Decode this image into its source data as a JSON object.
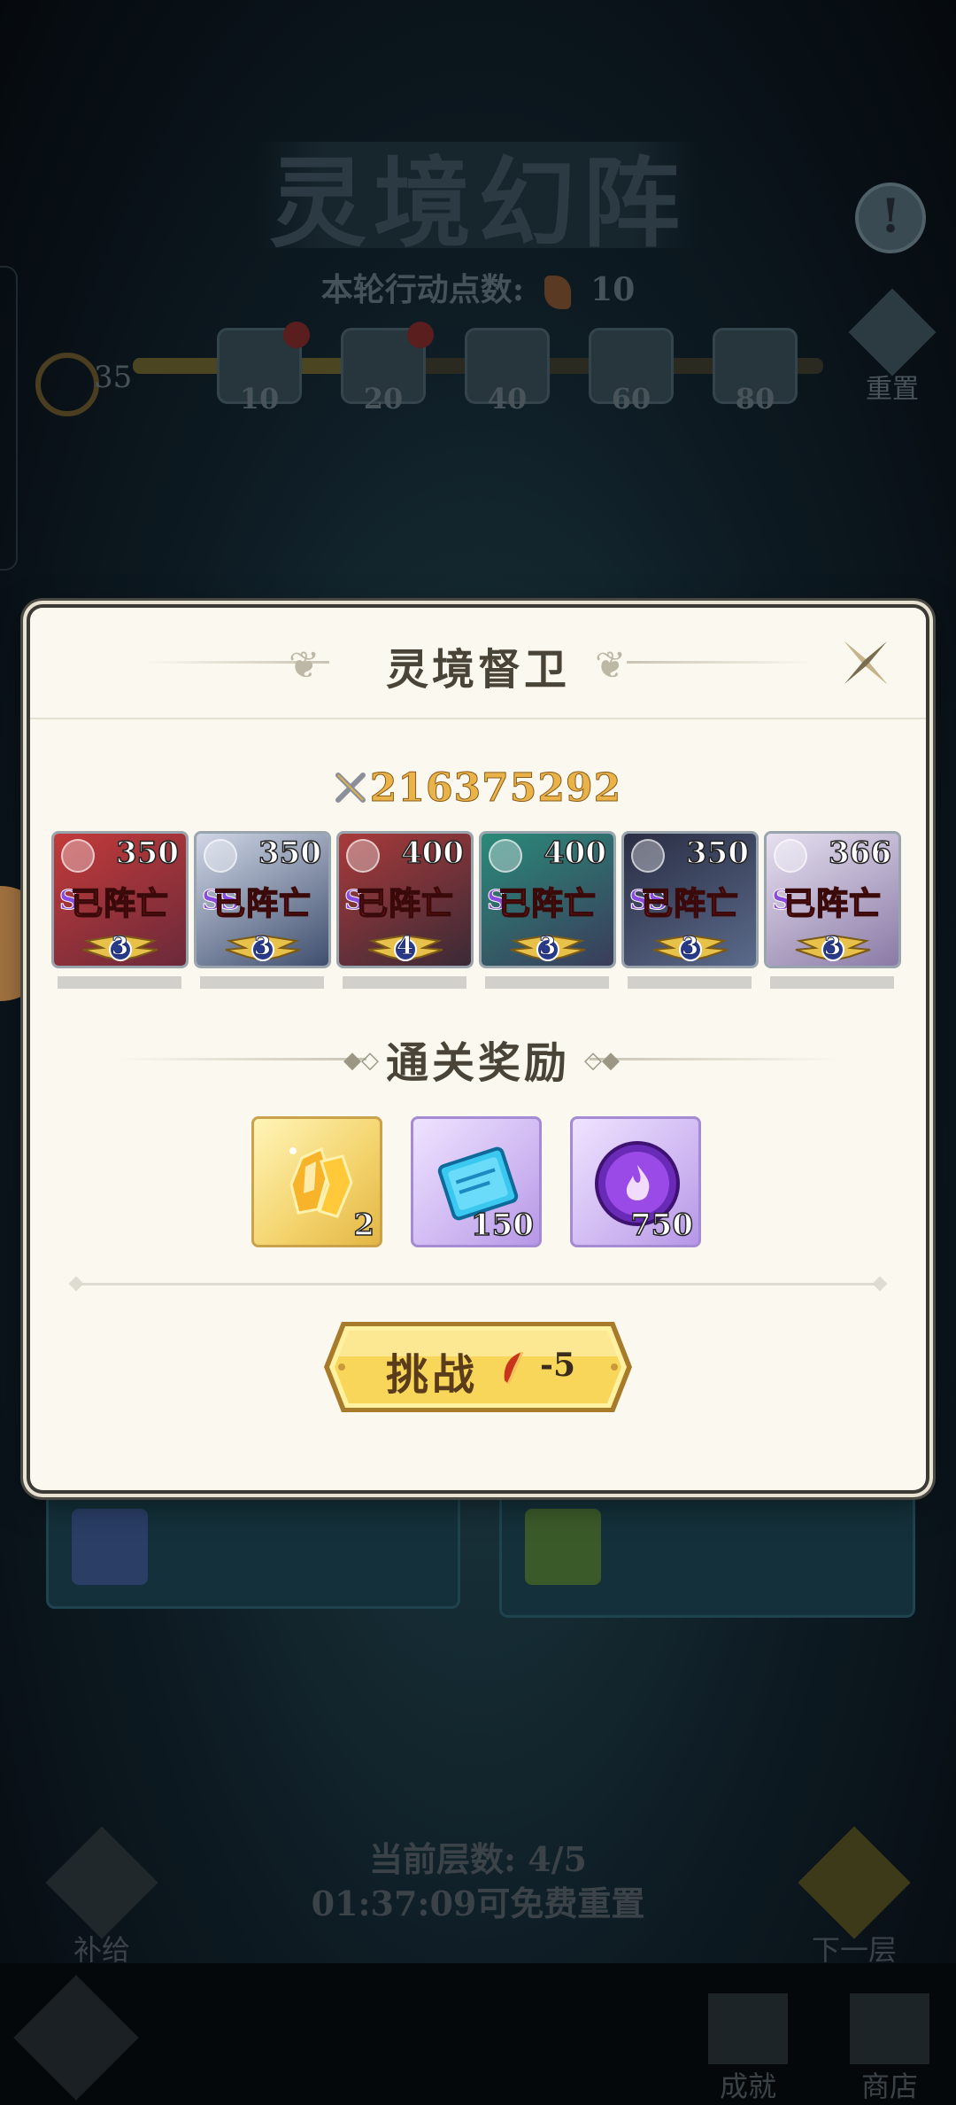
{
  "background": {
    "title": "灵境幻阵",
    "info_icon": "exclamation-icon",
    "action_points_label": "本轮行动点数:",
    "action_points_value": "10",
    "keys_count": "35",
    "chests": [
      "10",
      "20",
      "40",
      "60",
      "80"
    ],
    "reset_label": "重置",
    "floor_label": "当前层数: 4/5",
    "free_reset_label": "01:37:09可免费重置",
    "supply_label": "补给",
    "next_floor_label": "下一层",
    "achievement_label": "成就",
    "shop_label": "商店"
  },
  "modal": {
    "title": "灵境督卫",
    "combat_power": "216375292",
    "heroes": [
      {
        "level": "350",
        "grade": "S",
        "status": "已阵亡",
        "stars": "3",
        "colors": [
          "#c23a3a",
          "#6b2a3a"
        ]
      },
      {
        "level": "350",
        "grade": "SS",
        "status": "已阵亡",
        "stars": "3",
        "colors": [
          "#cfd6e6",
          "#3f4f6e"
        ]
      },
      {
        "level": "400",
        "grade": "S",
        "status": "已阵亡",
        "stars": "4",
        "colors": [
          "#a93a3a",
          "#3a2a36"
        ]
      },
      {
        "level": "400",
        "grade": "S",
        "status": "已阵亡",
        "stars": "3",
        "colors": [
          "#2a8a7a",
          "#3a3c5a"
        ]
      },
      {
        "level": "350",
        "grade": "SS",
        "status": "已阵亡",
        "stars": "3",
        "colors": [
          "#2a2e44",
          "#5a6a8a"
        ]
      },
      {
        "level": "366",
        "grade": "S",
        "status": "已阵亡",
        "stars": "3",
        "colors": [
          "#e6e0f0",
          "#8a7aa6"
        ]
      }
    ],
    "rewards_title": "通关奖励",
    "rewards": [
      {
        "icon": "gold-crystal-icon",
        "quantity": "2",
        "style": "gold"
      },
      {
        "icon": "blue-ticket-icon",
        "quantity": "150",
        "style": "purple"
      },
      {
        "icon": "purple-flame-orb-icon",
        "quantity": "750",
        "style": "purple"
      }
    ],
    "challenge_label": "挑战",
    "challenge_cost": "-5",
    "close_icon": "close-icon"
  },
  "colors": {
    "accent_gold": "#f3d26a",
    "power_text": "#e9b34a",
    "dead_text": "#e1262b",
    "modal_bg": "#fbf8ef"
  }
}
